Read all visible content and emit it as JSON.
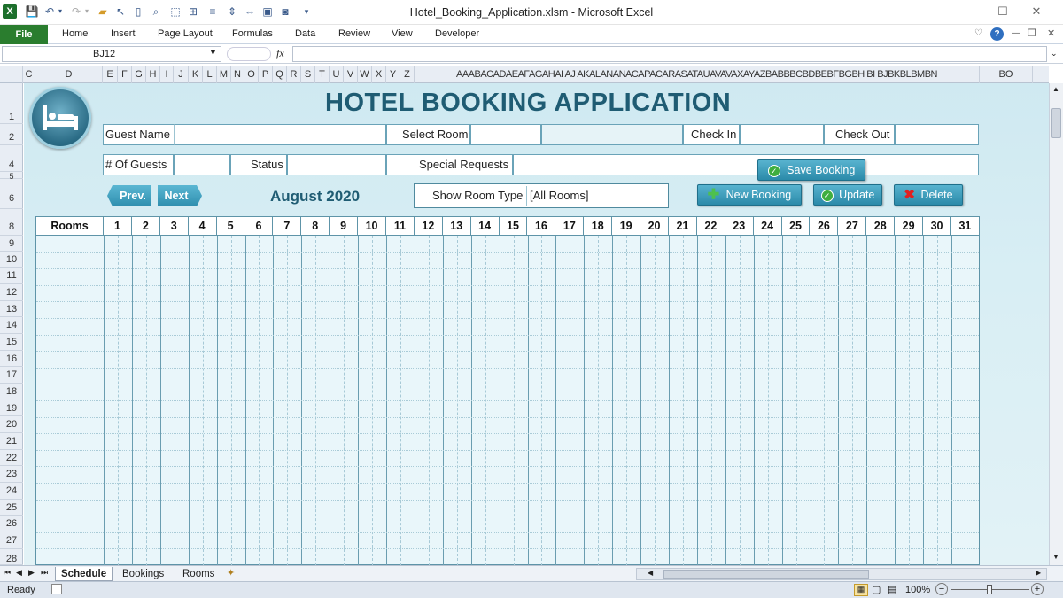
{
  "window": {
    "title": "Hotel_Booking_Application.xlsm  -  Microsoft Excel",
    "excel_icon": "X",
    "qat_icons": [
      "save-icon",
      "undo-icon",
      "redo-icon",
      "open-icon",
      "pointer-icon",
      "new-doc-icon",
      "print-preview-icon",
      "select-objects-icon",
      "group-icon",
      "align-icon",
      "move-icon",
      "shapes-icon",
      "picture-icon",
      "camera-icon",
      "customize-icon"
    ]
  },
  "ribbon": {
    "file": "File",
    "tabs": [
      "Home",
      "Insert",
      "Page Layout",
      "Formulas",
      "Data",
      "Review",
      "View",
      "Developer"
    ]
  },
  "formula_bar": {
    "name_box": "BJ12",
    "fx": "fx",
    "value": ""
  },
  "columns": [
    {
      "label": "C"
    },
    {
      "label": "D"
    },
    {
      "label": "E"
    },
    {
      "label": "F"
    },
    {
      "label": "G"
    },
    {
      "label": "H"
    },
    {
      "label": "I"
    },
    {
      "label": "J"
    },
    {
      "label": "K"
    },
    {
      "label": "L"
    },
    {
      "label": "M"
    },
    {
      "label": "N"
    },
    {
      "label": "O"
    },
    {
      "label": "P"
    },
    {
      "label": "Q"
    },
    {
      "label": "R"
    },
    {
      "label": "S"
    },
    {
      "label": "T"
    },
    {
      "label": "U"
    },
    {
      "label": "V"
    },
    {
      "label": "W"
    },
    {
      "label": "X"
    },
    {
      "label": "Y"
    },
    {
      "label": "Z"
    },
    {
      "label": "AAABACADAEAFAGAHAI AJ AKALANANACAPACARASATAUAVAVAXAYAZBABBBCBDBEBFBGBH BI BJBKBLBMBN"
    },
    {
      "label": "BO"
    }
  ],
  "rows": [
    "1",
    "2",
    "4",
    "5",
    "6",
    "8",
    "9",
    "10",
    "11",
    "12",
    "13",
    "14",
    "15",
    "16",
    "17",
    "18",
    "19",
    "20",
    "21",
    "22",
    "23",
    "24",
    "25",
    "26",
    "27",
    "28"
  ],
  "app": {
    "heading": "HOTEL BOOKING APPLICATION",
    "guest_name_label": "Guest Name",
    "select_room_label": "Select Room",
    "check_in_label": "Check In",
    "check_out_label": "Check Out",
    "guests_label": "# Of Guests",
    "status_label": "Status",
    "special_requests_label": "Special Requests",
    "save_booking": "Save Booking",
    "prev": "Prev.",
    "next": "Next",
    "month": "August 2020",
    "show_room_type_label": "Show Room Type",
    "show_room_type_value": "[All Rooms]",
    "new_booking": "New Booking",
    "update": "Update",
    "delete": "Delete",
    "rooms_header": "Rooms",
    "days": [
      "1",
      "2",
      "3",
      "4",
      "5",
      "6",
      "7",
      "8",
      "9",
      "10",
      "11",
      "12",
      "13",
      "14",
      "15",
      "16",
      "17",
      "18",
      "19",
      "20",
      "21",
      "22",
      "23",
      "24",
      "25",
      "26",
      "27",
      "28",
      "29",
      "30",
      "31"
    ]
  },
  "sheet_tabs": [
    "Schedule",
    "Bookings",
    "Rooms"
  ],
  "active_sheet": "Schedule",
  "status": {
    "ready": "Ready",
    "zoom": "100%"
  },
  "colors": {
    "heading": "#1f5c73",
    "file_tab": "#2a7d2e",
    "button": "#2b8aa9",
    "sheet_bg": "#d8eef4"
  }
}
